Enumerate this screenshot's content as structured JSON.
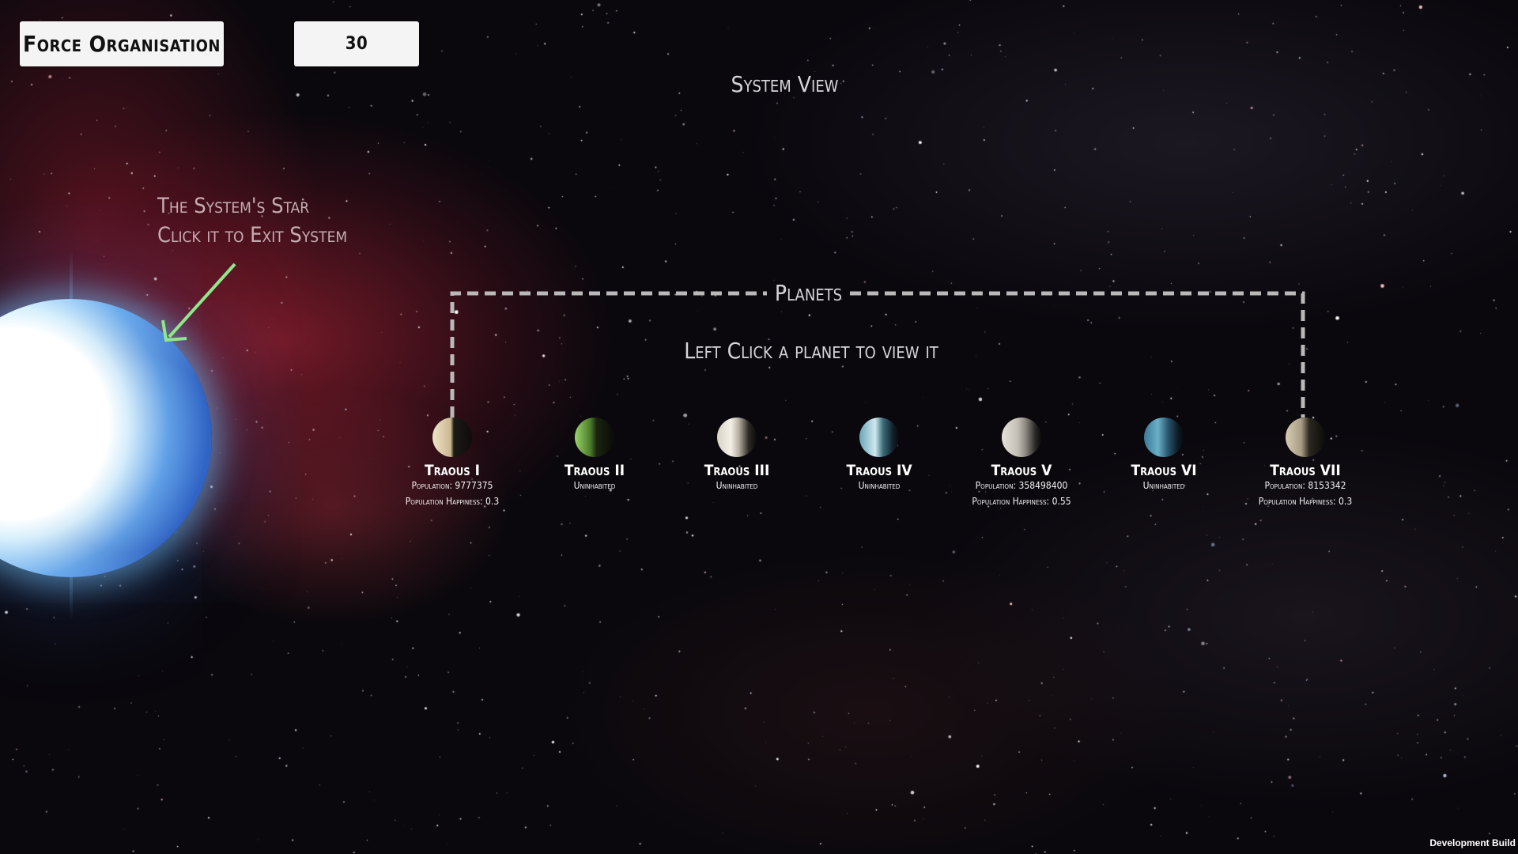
{
  "header": {
    "force_button_label": "Force Organisation",
    "count_value": "30"
  },
  "view_title": "System View",
  "star": {
    "hint_line_1": "The System's Star",
    "hint_line_2": "Click it to Exit System",
    "arrow_color": "#8ee88a"
  },
  "planets_section": {
    "label": "Planets",
    "hint": "Left Click a planet to view it",
    "items": [
      {
        "name": "Traous I",
        "info_1": "Population: 9777375",
        "info_2": "Population Happiness: 0.3"
      },
      {
        "name": "Traous II",
        "info_1": "Uninhabited",
        "info_2": ""
      },
      {
        "name": "Traous III",
        "info_1": "Uninhabited",
        "info_2": ""
      },
      {
        "name": "Traous IV",
        "info_1": "Uninhabited",
        "info_2": ""
      },
      {
        "name": "Traous V",
        "info_1": "Population: 358498400",
        "info_2": "Population Happiness: 0.55"
      },
      {
        "name": "Traous VI",
        "info_1": "Uninhabited",
        "info_2": ""
      },
      {
        "name": "Traous VII",
        "info_1": "Population: 8153342",
        "info_2": "Population Happiness: 0.3"
      }
    ]
  },
  "footer": {
    "build_label": "Development Build"
  }
}
